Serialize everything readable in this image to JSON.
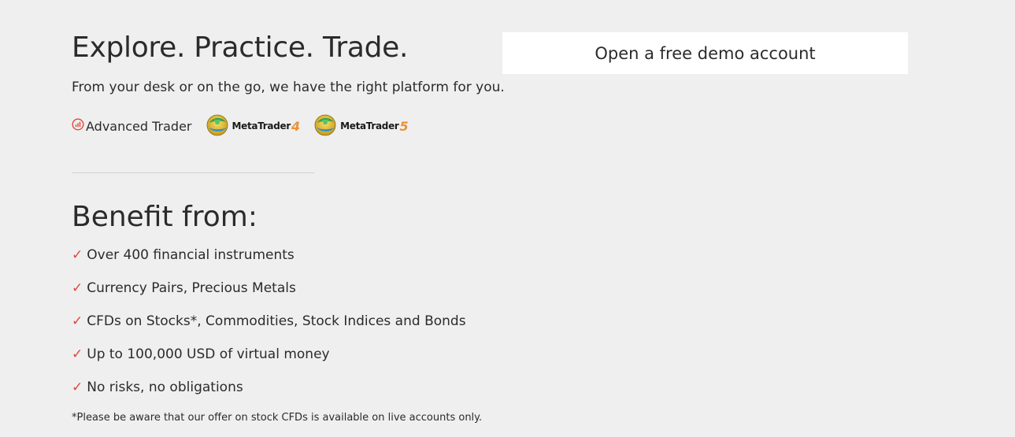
{
  "hero": {
    "headline": "Explore. Practice. Trade.",
    "subline": "From your desk or on the go, we have the right platform for you."
  },
  "platforms": [
    {
      "name": "Advanced Trader",
      "icon": "advanced-trader-icon"
    },
    {
      "name": "MetaTrader",
      "version": "4",
      "icon": "metatrader-icon"
    },
    {
      "name": "MetaTrader",
      "version": "5",
      "icon": "metatrader-icon"
    }
  ],
  "benefits": {
    "title": "Benefit from:",
    "check_glyph": "✓",
    "items": [
      "Over 400 financial instruments",
      "Currency Pairs, Precious Metals",
      "CFDs on Stocks*, Commodities, Stock Indices and Bonds",
      "Up to 100,000 USD of virtual money",
      "No risks, no obligations"
    ],
    "note": "*Please be aware that our offer on stock CFDs is available on live accounts only."
  },
  "demo_panel": {
    "title": "Open a free demo account"
  },
  "colors": {
    "background": "#efefef",
    "accent": "#e0463b",
    "metatrader_accent": "#e8923a",
    "panel": "#ffffff"
  }
}
